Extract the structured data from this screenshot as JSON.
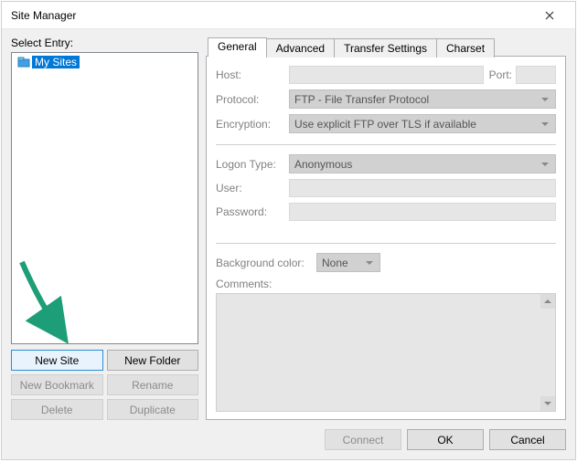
{
  "window": {
    "title": "Site Manager"
  },
  "left": {
    "select_label": "Select Entry:",
    "tree": {
      "root_label": "My Sites"
    },
    "buttons": {
      "new_site": "New Site",
      "new_folder": "New Folder",
      "new_bookmark": "New Bookmark",
      "rename": "Rename",
      "delete": "Delete",
      "duplicate": "Duplicate"
    }
  },
  "tabs": {
    "general": "General",
    "advanced": "Advanced",
    "transfer": "Transfer Settings",
    "charset": "Charset"
  },
  "general": {
    "host_label": "Host:",
    "port_label": "Port:",
    "protocol_label": "Protocol:",
    "protocol_value": "FTP - File Transfer Protocol",
    "encryption_label": "Encryption:",
    "encryption_value": "Use explicit FTP over TLS if available",
    "logon_label": "Logon Type:",
    "logon_value": "Anonymous",
    "user_label": "User:",
    "password_label": "Password:",
    "bgcolor_label": "Background color:",
    "bgcolor_value": "None",
    "comments_label": "Comments:"
  },
  "footer": {
    "connect": "Connect",
    "ok": "OK",
    "cancel": "Cancel"
  }
}
